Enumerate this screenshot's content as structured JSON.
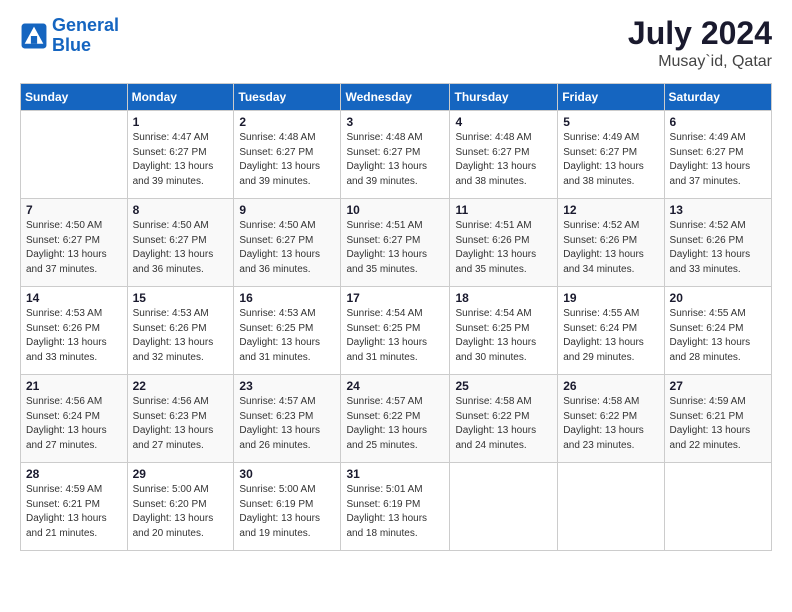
{
  "logo": {
    "line1": "General",
    "line2": "Blue"
  },
  "header": {
    "month": "July 2024",
    "location": "Musay`id, Qatar"
  },
  "weekdays": [
    "Sunday",
    "Monday",
    "Tuesday",
    "Wednesday",
    "Thursday",
    "Friday",
    "Saturday"
  ],
  "weeks": [
    [
      {
        "day": "",
        "info": ""
      },
      {
        "day": "1",
        "info": "Sunrise: 4:47 AM\nSunset: 6:27 PM\nDaylight: 13 hours\nand 39 minutes."
      },
      {
        "day": "2",
        "info": "Sunrise: 4:48 AM\nSunset: 6:27 PM\nDaylight: 13 hours\nand 39 minutes."
      },
      {
        "day": "3",
        "info": "Sunrise: 4:48 AM\nSunset: 6:27 PM\nDaylight: 13 hours\nand 39 minutes."
      },
      {
        "day": "4",
        "info": "Sunrise: 4:48 AM\nSunset: 6:27 PM\nDaylight: 13 hours\nand 38 minutes."
      },
      {
        "day": "5",
        "info": "Sunrise: 4:49 AM\nSunset: 6:27 PM\nDaylight: 13 hours\nand 38 minutes."
      },
      {
        "day": "6",
        "info": "Sunrise: 4:49 AM\nSunset: 6:27 PM\nDaylight: 13 hours\nand 37 minutes."
      }
    ],
    [
      {
        "day": "7",
        "info": "Sunrise: 4:50 AM\nSunset: 6:27 PM\nDaylight: 13 hours\nand 37 minutes."
      },
      {
        "day": "8",
        "info": "Sunrise: 4:50 AM\nSunset: 6:27 PM\nDaylight: 13 hours\nand 36 minutes."
      },
      {
        "day": "9",
        "info": "Sunrise: 4:50 AM\nSunset: 6:27 PM\nDaylight: 13 hours\nand 36 minutes."
      },
      {
        "day": "10",
        "info": "Sunrise: 4:51 AM\nSunset: 6:27 PM\nDaylight: 13 hours\nand 35 minutes."
      },
      {
        "day": "11",
        "info": "Sunrise: 4:51 AM\nSunset: 6:26 PM\nDaylight: 13 hours\nand 35 minutes."
      },
      {
        "day": "12",
        "info": "Sunrise: 4:52 AM\nSunset: 6:26 PM\nDaylight: 13 hours\nand 34 minutes."
      },
      {
        "day": "13",
        "info": "Sunrise: 4:52 AM\nSunset: 6:26 PM\nDaylight: 13 hours\nand 33 minutes."
      }
    ],
    [
      {
        "day": "14",
        "info": "Sunrise: 4:53 AM\nSunset: 6:26 PM\nDaylight: 13 hours\nand 33 minutes."
      },
      {
        "day": "15",
        "info": "Sunrise: 4:53 AM\nSunset: 6:26 PM\nDaylight: 13 hours\nand 32 minutes."
      },
      {
        "day": "16",
        "info": "Sunrise: 4:53 AM\nSunset: 6:25 PM\nDaylight: 13 hours\nand 31 minutes."
      },
      {
        "day": "17",
        "info": "Sunrise: 4:54 AM\nSunset: 6:25 PM\nDaylight: 13 hours\nand 31 minutes."
      },
      {
        "day": "18",
        "info": "Sunrise: 4:54 AM\nSunset: 6:25 PM\nDaylight: 13 hours\nand 30 minutes."
      },
      {
        "day": "19",
        "info": "Sunrise: 4:55 AM\nSunset: 6:24 PM\nDaylight: 13 hours\nand 29 minutes."
      },
      {
        "day": "20",
        "info": "Sunrise: 4:55 AM\nSunset: 6:24 PM\nDaylight: 13 hours\nand 28 minutes."
      }
    ],
    [
      {
        "day": "21",
        "info": "Sunrise: 4:56 AM\nSunset: 6:24 PM\nDaylight: 13 hours\nand 27 minutes."
      },
      {
        "day": "22",
        "info": "Sunrise: 4:56 AM\nSunset: 6:23 PM\nDaylight: 13 hours\nand 27 minutes."
      },
      {
        "day": "23",
        "info": "Sunrise: 4:57 AM\nSunset: 6:23 PM\nDaylight: 13 hours\nand 26 minutes."
      },
      {
        "day": "24",
        "info": "Sunrise: 4:57 AM\nSunset: 6:22 PM\nDaylight: 13 hours\nand 25 minutes."
      },
      {
        "day": "25",
        "info": "Sunrise: 4:58 AM\nSunset: 6:22 PM\nDaylight: 13 hours\nand 24 minutes."
      },
      {
        "day": "26",
        "info": "Sunrise: 4:58 AM\nSunset: 6:22 PM\nDaylight: 13 hours\nand 23 minutes."
      },
      {
        "day": "27",
        "info": "Sunrise: 4:59 AM\nSunset: 6:21 PM\nDaylight: 13 hours\nand 22 minutes."
      }
    ],
    [
      {
        "day": "28",
        "info": "Sunrise: 4:59 AM\nSunset: 6:21 PM\nDaylight: 13 hours\nand 21 minutes."
      },
      {
        "day": "29",
        "info": "Sunrise: 5:00 AM\nSunset: 6:20 PM\nDaylight: 13 hours\nand 20 minutes."
      },
      {
        "day": "30",
        "info": "Sunrise: 5:00 AM\nSunset: 6:19 PM\nDaylight: 13 hours\nand 19 minutes."
      },
      {
        "day": "31",
        "info": "Sunrise: 5:01 AM\nSunset: 6:19 PM\nDaylight: 13 hours\nand 18 minutes."
      },
      {
        "day": "",
        "info": ""
      },
      {
        "day": "",
        "info": ""
      },
      {
        "day": "",
        "info": ""
      }
    ]
  ]
}
